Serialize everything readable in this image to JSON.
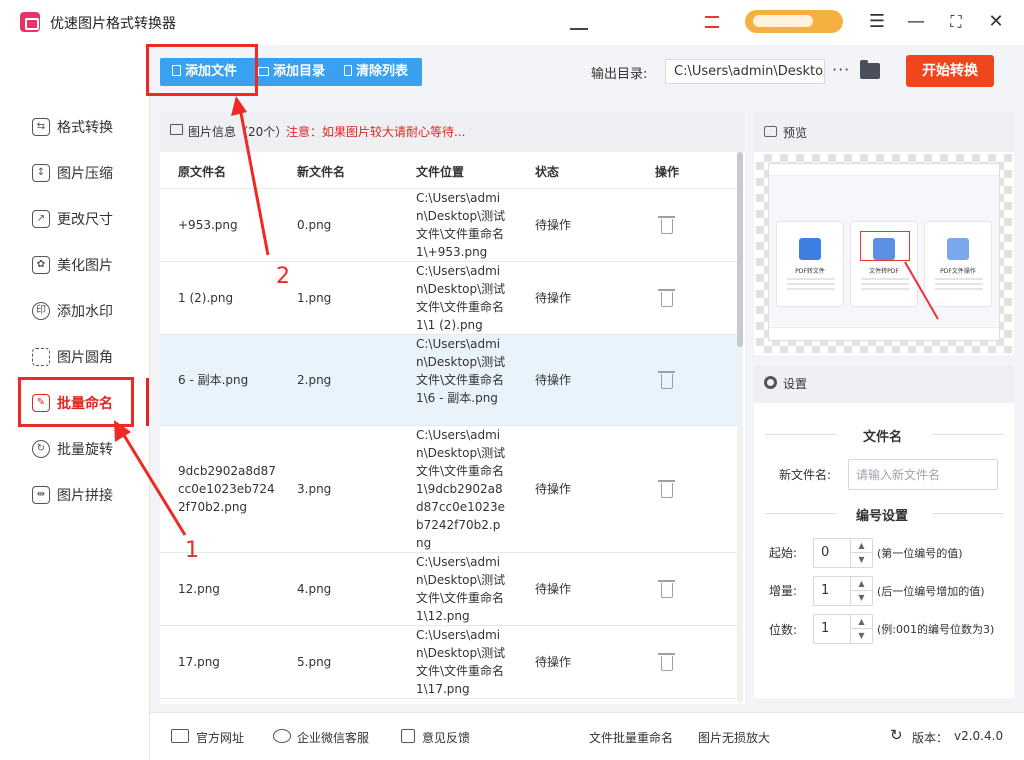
{
  "app": {
    "title": "优速图片格式转换器"
  },
  "sidebar": {
    "items": [
      {
        "label": "格式转换",
        "icon": "convert-icon"
      },
      {
        "label": "图片压缩",
        "icon": "compress-icon"
      },
      {
        "label": "更改尺寸",
        "icon": "resize-icon"
      },
      {
        "label": "美化图片",
        "icon": "beautify-icon"
      },
      {
        "label": "添加水印",
        "icon": "watermark-icon"
      },
      {
        "label": "图片圆角",
        "icon": "round-corner-icon"
      },
      {
        "label": "批量命名",
        "icon": "rename-icon",
        "active": true
      },
      {
        "label": "批量旋转",
        "icon": "rotate-icon"
      },
      {
        "label": "图片拼接",
        "icon": "stitch-icon"
      }
    ]
  },
  "toolbar": {
    "add_file": "添加文件",
    "add_dir": "添加目录",
    "clear_list": "清除列表",
    "output_label": "输出目录:",
    "output_path": "C:\\Users\\admin\\Deskto",
    "more": "···",
    "start": "开始转换"
  },
  "callouts": {
    "one": "1",
    "two": "2"
  },
  "file_panel": {
    "info": "图片信息（20个）",
    "warning": "注意：如果图片较大请耐心等待...",
    "columns": [
      "原文件名",
      "新文件名",
      "文件位置",
      "状态",
      "操作"
    ],
    "rows": [
      {
        "orig": "+953.png",
        "new": "0.png",
        "path": "C:\\Users\\admin\\Desktop\\测试文件\\文件重命名1\\+953.png",
        "status": "待操作"
      },
      {
        "orig": "1 (2).png",
        "new": "1.png",
        "path": "C:\\Users\\admin\\Desktop\\测试文件\\文件重命名1\\1 (2).png",
        "status": "待操作"
      },
      {
        "orig": "6 - 副本.png",
        "new": "2.png",
        "path": "C:\\Users\\admin\\Desktop\\测试文件\\文件重命名1\\6 - 副本.png",
        "status": "待操作"
      },
      {
        "orig": "9dcb2902a8d87cc0e1023eb7242f70b2.png",
        "new": "3.png",
        "path": "C:\\Users\\admin\\Desktop\\测试文件\\文件重命名1\\9dcb2902a8d87cc0e1023eb7242f70b2.png",
        "status": "待操作"
      },
      {
        "orig": "12.png",
        "new": "4.png",
        "path": "C:\\Users\\admin\\Desktop\\测试文件\\文件重命名1\\12.png",
        "status": "待操作"
      },
      {
        "orig": "17.png",
        "new": "5.png",
        "path": "C:\\Users\\admin\\Desktop\\测试文件\\文件重命名1\\17.png",
        "status": "待操作"
      }
    ]
  },
  "preview": {
    "title": "预览",
    "cards": [
      "PDF转文件",
      "文件转PDF",
      "PDF文件操作"
    ]
  },
  "settings": {
    "title": "设置",
    "filename_section": "文件名",
    "new_name_label": "新文件名:",
    "new_name_placeholder": "请输入新文件名",
    "numbering_section": "编号设置",
    "start_label": "起始:",
    "start_value": "0",
    "start_hint": "(第一位编号的值)",
    "step_label": "增量:",
    "step_value": "1",
    "step_hint": "(后一位编号增加的值)",
    "digits_label": "位数:",
    "digits_value": "1",
    "digits_hint": "(例:001的编号位数为3)"
  },
  "footer": {
    "website": "官方网址",
    "wechat": "企业微信客服",
    "feedback": "意见反馈",
    "batch_rename": "文件批量重命名",
    "lossless": "图片无损放大",
    "version_label": "版本：",
    "version": "v2.0.4.0"
  }
}
